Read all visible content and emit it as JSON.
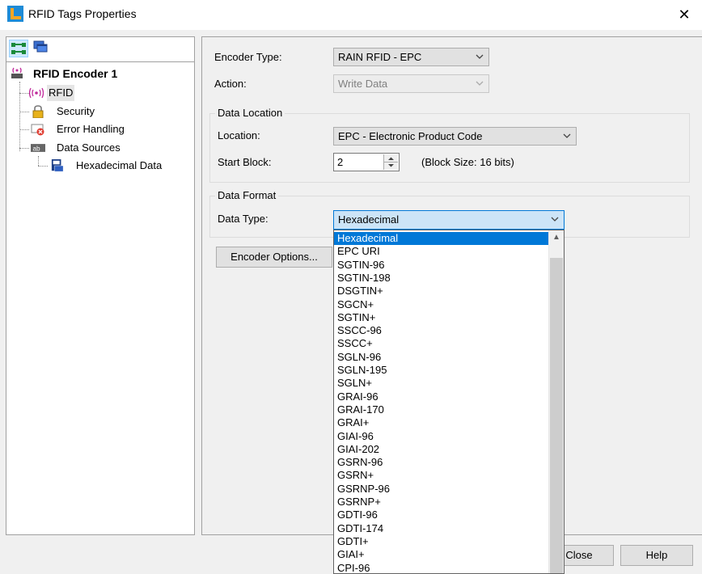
{
  "window": {
    "title": "RFID Tags Properties",
    "close_glyph": "✕"
  },
  "tree": {
    "root": "RFID Encoder 1",
    "items": [
      "RFID",
      "Security",
      "Error Handling",
      "Data Sources",
      "Hexadecimal Data"
    ]
  },
  "form": {
    "encoder_type_label": "Encoder Type:",
    "encoder_type_value": "RAIN RFID - EPC",
    "action_label": "Action:",
    "action_value": "Write Data",
    "data_location_group": "Data Location",
    "location_label": "Location:",
    "location_value": "EPC - Electronic Product Code",
    "start_block_label": "Start Block:",
    "start_block_value": "2",
    "block_size_text": "(Block Size: 16 bits)",
    "data_format_group": "Data Format",
    "data_type_label": "Data Type:",
    "data_type_value": "Hexadecimal",
    "encoder_options_button": "Encoder Options..."
  },
  "buttons": {
    "close": "Close",
    "help": "Help"
  },
  "dropdown": {
    "options": [
      "Hexadecimal",
      "EPC URI",
      "SGTIN-96",
      "SGTIN-198",
      "DSGTIN+",
      "SGCN+",
      "SGTIN+",
      "SSCC-96",
      "SSCC+",
      "SGLN-96",
      "SGLN-195",
      "SGLN+",
      "GRAI-96",
      "GRAI-170",
      "GRAI+",
      "GIAI-96",
      "GIAI-202",
      "GSRN-96",
      "GSRN+",
      "GSRNP-96",
      "GSRNP+",
      "GDTI-96",
      "GDTI-174",
      "GDTI+",
      "GIAI+",
      "CPI-96"
    ],
    "selected_index": 0
  },
  "colors": {
    "selection": "#0078d7",
    "focus_border": "#0078d7",
    "tree_selected": "#cce8ff"
  }
}
